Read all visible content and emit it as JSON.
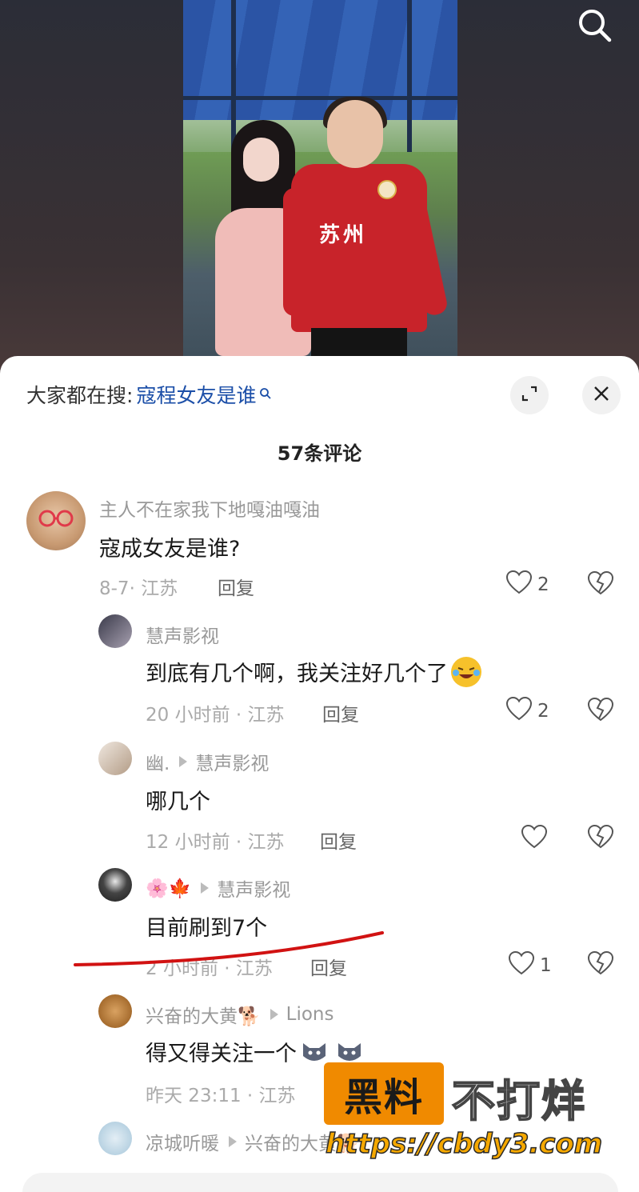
{
  "header": {
    "search_icon": "search-icon"
  },
  "panel": {
    "hot_search_prefix": "大家都在搜:",
    "hot_search_term": "寇程女友是谁",
    "expand_icon": "expand-icon",
    "close_icon": "close-icon",
    "comment_count": "57条评论"
  },
  "video": {
    "jersey_text": "苏州"
  },
  "comments": [
    {
      "user": "主人不在家我下地嘎油嘎油",
      "text": "寇成女友是谁?",
      "meta": "8-7· 江苏",
      "reply": "回复",
      "likes": "2"
    },
    {
      "user": "慧声影视",
      "text": "到底有几个啊，我关注好几个了",
      "meta": "20 小时前 · 江苏",
      "reply": "回复",
      "likes": "2"
    },
    {
      "user": "幽.",
      "reply_to": "慧声影视",
      "text": "哪几个",
      "meta": "12 小时前 · 江苏",
      "reply": "回复",
      "likes": ""
    },
    {
      "user": "🌸🍁",
      "reply_to": "慧声影视",
      "text": "目前刷到7个",
      "meta": "2 小时前 · 江苏",
      "reply": "回复",
      "likes": "1"
    },
    {
      "user": "兴奋的大黄🐕",
      "reply_to": "Lions",
      "text": "得又得关注一个",
      "meta": "昨天 23:11 · 江苏",
      "reply": "",
      "likes": ""
    },
    {
      "user": "凉城听暖",
      "reply_to": "兴奋的大黄🐕",
      "text": "",
      "meta": "",
      "reply": "",
      "likes": ""
    }
  ],
  "watermark": {
    "box_text": "黑料",
    "right_text": "不打烊",
    "url": "https://cbdy3.com"
  }
}
